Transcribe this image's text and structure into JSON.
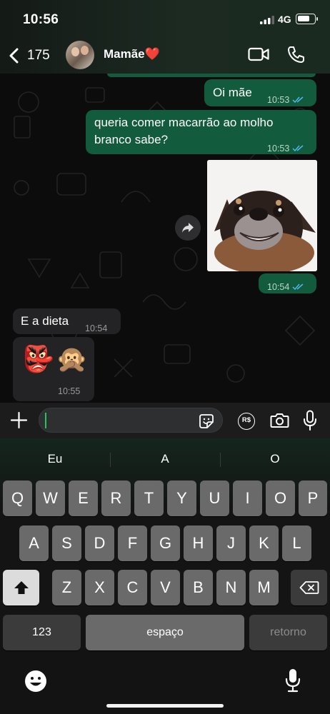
{
  "status_bar": {
    "time": "10:56",
    "network": "4G",
    "battery_level": 0.75
  },
  "header": {
    "back_count": "175",
    "contact_name": "Mamãe",
    "contact_emoji": "❤️"
  },
  "colors": {
    "outgoing_bubble": "#125b3c",
    "incoming_bubble": "#232325",
    "accent": "#26c35e"
  },
  "messages": [
    {
      "direction": "out",
      "text": "Oi mãe",
      "time": "10:53",
      "status": "read"
    },
    {
      "direction": "out",
      "text": "queria comer macarrão ao molho branco sabe?",
      "time": "10:53",
      "status": "read"
    },
    {
      "direction": "out",
      "type": "image",
      "image": "dog-smiling-photo",
      "time": "10:54",
      "status": "read"
    },
    {
      "direction": "in",
      "text": "E a dieta",
      "time": "10:54"
    },
    {
      "direction": "in",
      "type": "emoji",
      "emojis": [
        "👺",
        "🙊"
      ],
      "time": "10:55"
    }
  ],
  "input": {
    "value": "",
    "placeholder": ""
  },
  "keyboard": {
    "suggestions": [
      "Eu",
      "A",
      "O"
    ],
    "row1": [
      "Q",
      "W",
      "E",
      "R",
      "T",
      "Y",
      "U",
      "I",
      "O",
      "P"
    ],
    "row2": [
      "A",
      "S",
      "D",
      "F",
      "G",
      "H",
      "J",
      "K",
      "L"
    ],
    "row3": [
      "Z",
      "X",
      "C",
      "V",
      "B",
      "N",
      "M"
    ],
    "numbers_label": "123",
    "space_label": "espaço",
    "return_label": "retorno"
  },
  "icons": [
    "back-chevron-icon",
    "video-call-icon",
    "phone-icon",
    "forward-icon",
    "plus-icon",
    "sticker-icon",
    "camera-icon",
    "microphone-icon",
    "shift-icon",
    "backspace-icon",
    "emoji-icon",
    "dictation-icon"
  ]
}
